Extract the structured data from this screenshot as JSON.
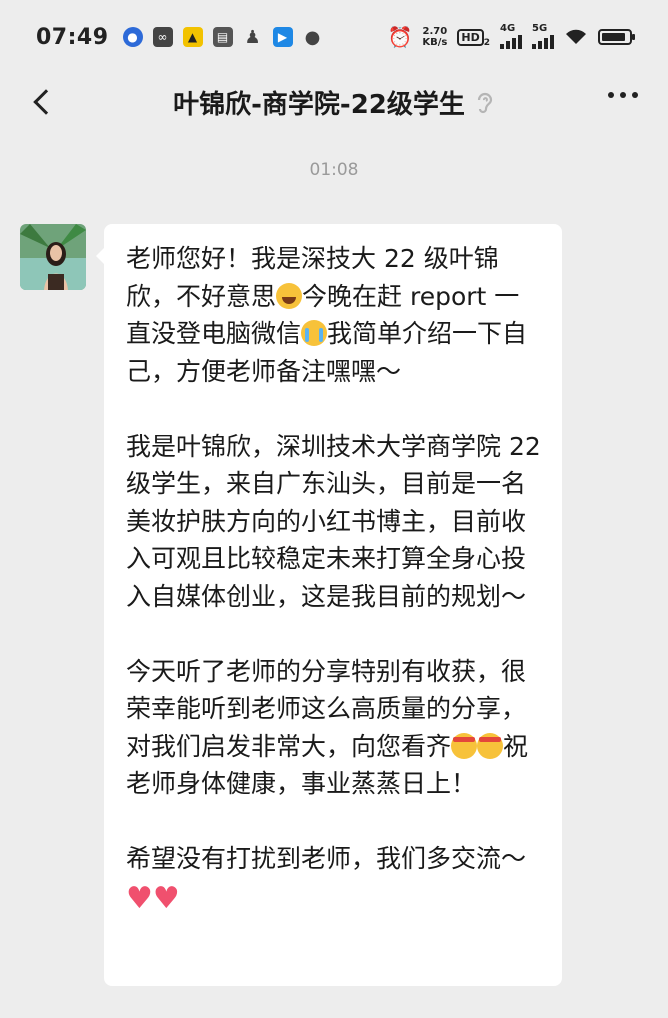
{
  "status_bar": {
    "time": "07:49",
    "net_speed_value": "2.70",
    "net_speed_unit": "KB/s",
    "hd_label": "HD",
    "hd_sub": "2",
    "signal1_label": "4G",
    "signal2_label": "5G",
    "battery_level": 0.9
  },
  "nav": {
    "title": "叶锦欣-商学院-22级学生",
    "mute_icon": "ear-muted-icon"
  },
  "chat": {
    "timestamp": "01:08",
    "message": {
      "p1_a": "老师您好！我是深技大 22 级叶锦欣，不好意思",
      "p1_b": "今晚在赶 report 一直没登电脑微信",
      "p1_c": "我简单介绍一下自己，方便老师备注嘿嘿～",
      "p2": "我是叶锦欣，深圳技术大学商学院 22 级学生，来自广东汕头，目前是一名美妆护肤方向的小红书博主，目前收入可观且比较稳定未来打算全身心投入自媒体创业，这是我目前的规划〜",
      "p3_a": "今天听了老师的分享特别有收获，很荣幸能听到老师这么高质量的分享，对我们启发非常大，向您看齐",
      "p3_b": "祝老师身体健康，事业蒸蒸日上！",
      "p4": "希望没有打扰到老师，我们多交流〜"
    }
  },
  "colors": {
    "background": "#ededed",
    "bubble": "#ffffff",
    "timestamp": "#9a9a9a",
    "heart": "#f0506e"
  }
}
